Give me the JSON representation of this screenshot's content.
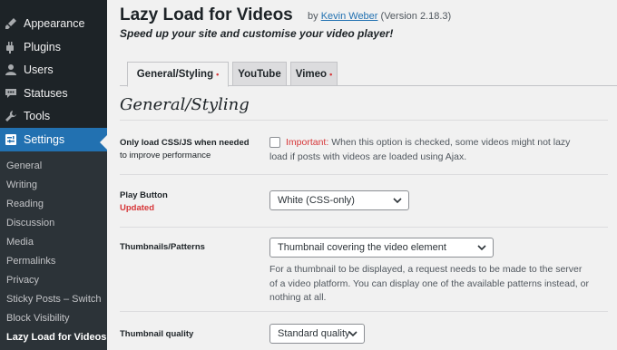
{
  "sidebar": {
    "menu": [
      {
        "label": "Appearance",
        "icon": "paintbrush-icon"
      },
      {
        "label": "Plugins",
        "icon": "plug-icon"
      },
      {
        "label": "Users",
        "icon": "user-icon"
      },
      {
        "label": "Statuses",
        "icon": "speech-bubble-icon"
      },
      {
        "label": "Tools",
        "icon": "wrench-icon"
      },
      {
        "label": "Settings",
        "icon": "settings-icon"
      }
    ],
    "submenu": [
      "General",
      "Writing",
      "Reading",
      "Discussion",
      "Media",
      "Permalinks",
      "Privacy",
      "Sticky Posts – Switch",
      "Block Visibility",
      "Lazy Load for Videos"
    ]
  },
  "header": {
    "title": "Lazy Load for Videos",
    "by": "by",
    "author": "Kevin Weber",
    "version": "(Version 2.18.3)",
    "tagline": "Speed up your site and customise your video player!"
  },
  "tabs": [
    {
      "label": "General/Styling",
      "dot": "•"
    },
    {
      "label": "YouTube",
      "dot": ""
    },
    {
      "label": "Vimeo",
      "dot": "•"
    }
  ],
  "section_title": "General/Styling",
  "settings": {
    "css_js": {
      "label": "Only load CSS/JS when needed",
      "label2": "to improve performance",
      "important": "Important:",
      "desc1": " When this option is checked, some videos might not lazy",
      "desc2": "load if posts with videos are loaded using Ajax.",
      "checked": false
    },
    "play_button": {
      "label": "Play Button",
      "badge": "Updated",
      "value": "White (CSS-only)"
    },
    "thumbnails": {
      "label": "Thumbnails/Patterns",
      "value": "Thumbnail covering the video element",
      "desc1": "For a thumbnail to be displayed, a request needs to be made to the server",
      "desc2": "of a video platform. You can display one of the available patterns instead, or",
      "desc3": "nothing at all."
    },
    "quality": {
      "label": "Thumbnail quality",
      "value": "Standard quality"
    }
  },
  "colors": {
    "accent": "#2271b1",
    "alert": "#d63638",
    "sidebar": "#1d2327",
    "submenu": "#2c3338"
  }
}
